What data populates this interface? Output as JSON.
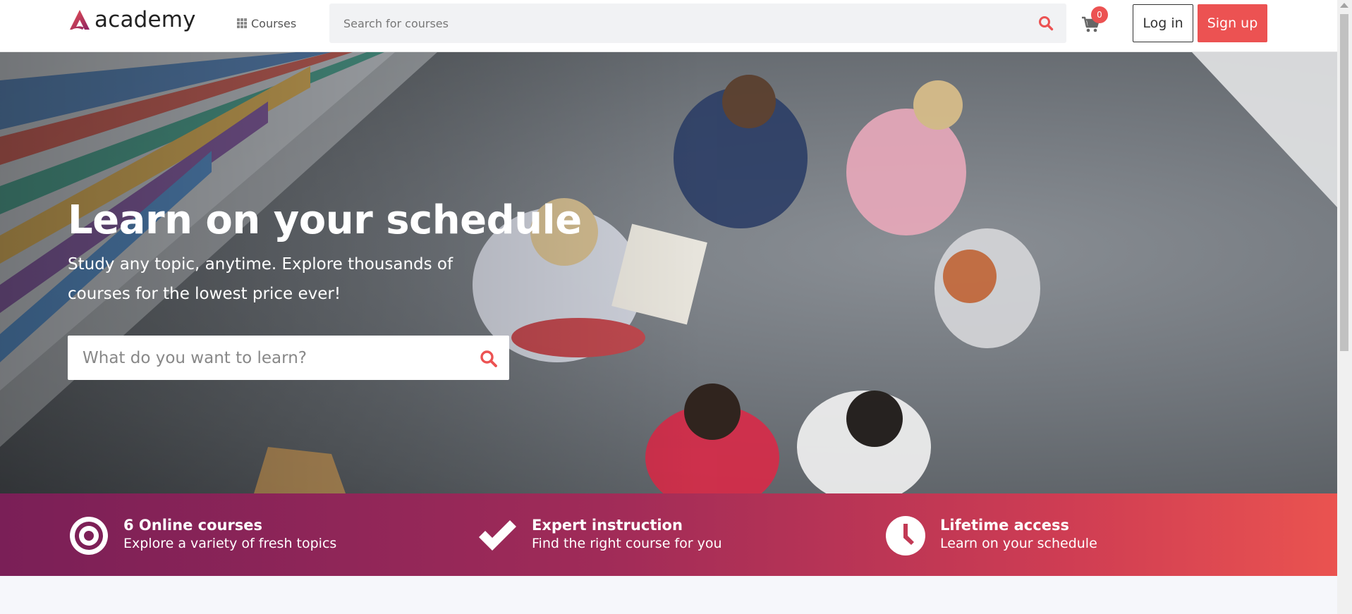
{
  "header": {
    "logo_text": "academy",
    "courses_label": "Courses",
    "search_placeholder": "Search for courses",
    "cart_count": "0",
    "login_label": "Log in",
    "signup_label": "Sign up"
  },
  "hero": {
    "title": "Learn on your schedule",
    "subtitle": "Study any topic, anytime. Explore thousands of courses for the lowest price ever!",
    "search_placeholder": "What do you want to learn?"
  },
  "features": [
    {
      "icon": "target-icon",
      "title": "6 Online courses",
      "desc": "Explore a variety of fresh topics"
    },
    {
      "icon": "check-icon",
      "title": "Expert instruction",
      "desc": "Find the right course for you"
    },
    {
      "icon": "clock-icon",
      "title": "Lifetime access",
      "desc": "Learn on your schedule"
    }
  ],
  "colors": {
    "accent": "#ec5252",
    "band_start": "#7a1f57",
    "band_end": "#ea5350"
  }
}
